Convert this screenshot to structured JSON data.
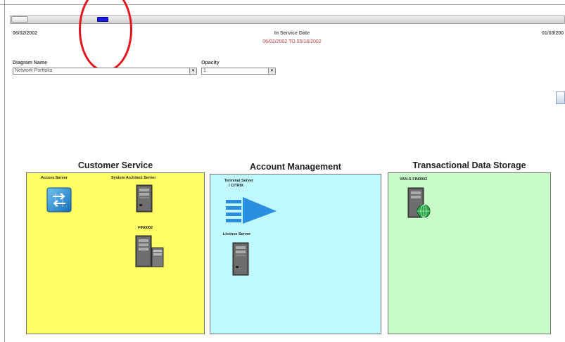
{
  "slider": {
    "start_date": "06/02/2002",
    "end_date": "01/03/200",
    "title": "In Service Date",
    "range": "06/02/2002 TO 05/18/2002"
  },
  "controls": {
    "diagram_name_label": "Diagram Name",
    "diagram_name_value": "Network Portfolio",
    "opacity_label": "Opacity",
    "opacity_value": "1"
  },
  "groups": [
    {
      "title": "Customer Service",
      "color": "#ffff66",
      "nodes": [
        {
          "label": "Access Server",
          "icon": "network-switch-icon"
        },
        {
          "label": "System Architect Server",
          "icon": "server-tower-icon"
        },
        {
          "label": "FIN0002",
          "icon": "server-cluster-icon"
        }
      ]
    },
    {
      "title": "Account Management",
      "color": "#bff8ff",
      "nodes": [
        {
          "label": "Terminal Server",
          "label2": "/ CITRIX",
          "icon": "terminal-server-arrow-icon"
        },
        {
          "label": "License Server",
          "icon": "server-tower-icon"
        }
      ]
    },
    {
      "title": "Transactional Data Storage",
      "color": "#c8fcc8",
      "nodes": [
        {
          "label": "VAN-S FIN0002",
          "icon": "web-server-icon"
        }
      ]
    }
  ],
  "annotation_color": "#e0141e"
}
